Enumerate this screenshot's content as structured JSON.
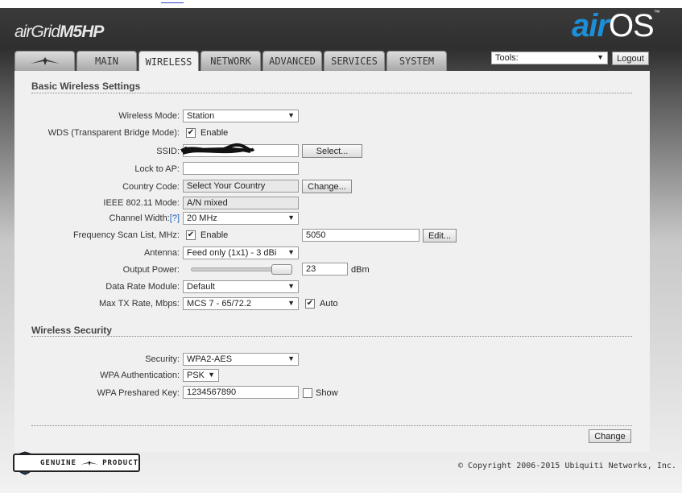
{
  "header": {
    "brand_prefix": "air",
    "brand_mid": "Grid",
    "brand_model": "M5HP",
    "logo_air": "air",
    "logo_os": "OS",
    "logo_tm": "™"
  },
  "tabs": [
    {
      "label": "",
      "icon": "ubiquiti-logo-icon"
    },
    {
      "label": "MAIN"
    },
    {
      "label": "WIRELESS",
      "active": true
    },
    {
      "label": "NETWORK"
    },
    {
      "label": "ADVANCED"
    },
    {
      "label": "SERVICES"
    },
    {
      "label": "SYSTEM"
    }
  ],
  "toolbar": {
    "tools_value": "Tools:",
    "logout_label": "Logout"
  },
  "basic": {
    "title": "Basic Wireless Settings",
    "wireless_mode_label": "Wireless Mode:",
    "wireless_mode_value": "Station",
    "wds_label": "WDS (Transparent Bridge Mode):",
    "wds_enable": "Enable",
    "ssid_label": "SSID:",
    "ssid_select": "Select...",
    "lock_label": "Lock to AP:",
    "lock_value": "",
    "country_label": "Country Code:",
    "country_value": "Select Your Country",
    "country_change": "Change...",
    "ieee_label": "IEEE 802.11 Mode:",
    "ieee_value": "A/N mixed",
    "channel_label": "Channel Width:",
    "channel_help": "[?]",
    "channel_value": "20 MHz",
    "freq_label": "Frequency Scan List, MHz:",
    "freq_enable": "Enable",
    "freq_value": "5050",
    "freq_edit": "Edit...",
    "antenna_label": "Antenna:",
    "antenna_value": "Feed only (1x1) - 3 dBi",
    "output_label": "Output Power:",
    "output_value": "23",
    "output_unit": "dBm",
    "output_level": 1.0,
    "rate_label": "Data Rate Module:",
    "rate_value": "Default",
    "maxtx_label": "Max TX Rate, Mbps:",
    "maxtx_value": "MCS 7 - 65/72.2",
    "maxtx_auto": "Auto"
  },
  "security": {
    "title": "Wireless Security",
    "security_label": "Security:",
    "security_value": "WPA2-AES",
    "auth_label": "WPA Authentication:",
    "auth_value": "PSK",
    "key_label": "WPA Preshared Key:",
    "key_value": "1234567890",
    "show_label": "Show"
  },
  "footer": {
    "change_label": "Change",
    "copyright": "© Copyright 2006-2015 Ubiquiti Networks, Inc.",
    "genuine_left": "GENUINE",
    "genuine_right": "PRODUCT"
  }
}
